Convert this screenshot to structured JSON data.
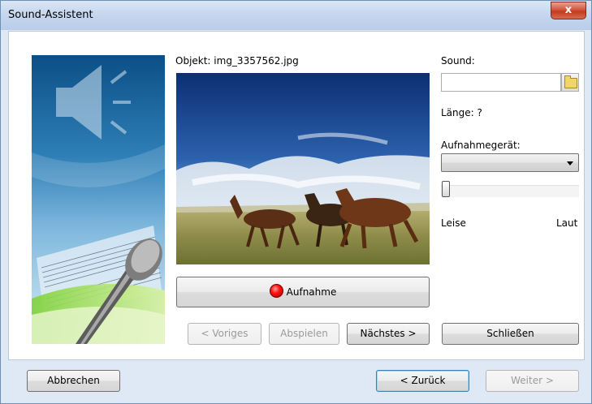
{
  "window": {
    "title": "Sound-Assistent",
    "close_glyph": "x"
  },
  "content": {
    "object_label": "Objekt: img_3357562.jpg",
    "record_button": "Aufnahme",
    "nav": {
      "previous": "< Voriges",
      "play": "Abspielen",
      "next": "Nächstes >"
    },
    "close_button": "Schließen"
  },
  "sound_panel": {
    "sound_label": "Sound:",
    "sound_value": "",
    "length_label": "Länge: ?",
    "device_label": "Aufnahmegerät:",
    "device_value": "",
    "volume_level": 0,
    "quiet_label": "Leise",
    "loud_label": "Laut"
  },
  "footer": {
    "cancel": "Abbrechen",
    "back": "< Zurück",
    "forward": "Weiter >"
  },
  "icons": {
    "folder": "folder-icon",
    "speaker": "speaker-icon",
    "microphone": "microphone-icon",
    "record": "record-dot-icon"
  },
  "colors": {
    "title_bar": "#c6d7ee",
    "close_button": "#c94a2f",
    "default_button_border": "#3c7fb1",
    "window_border": "#6d8fb3"
  }
}
